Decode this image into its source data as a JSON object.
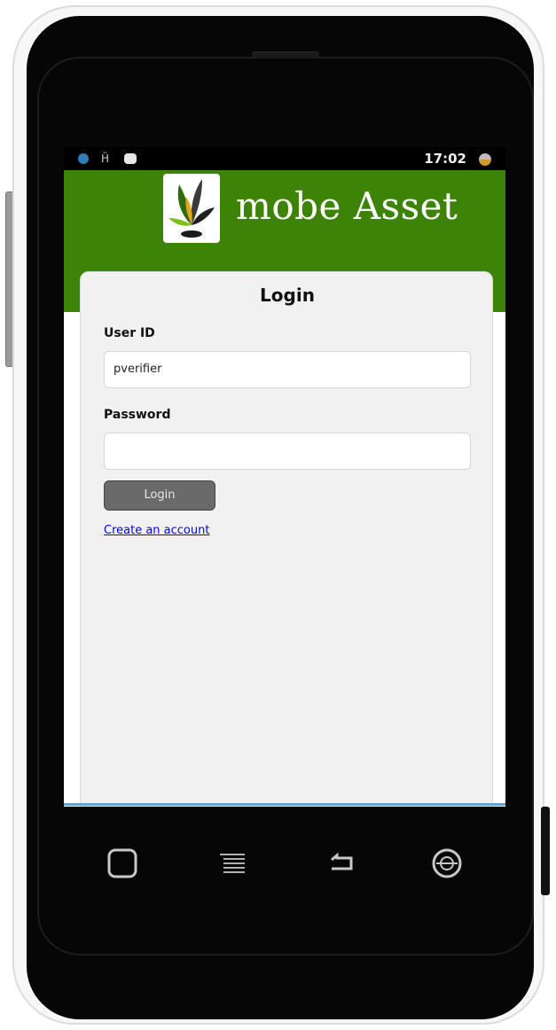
{
  "status_bar": {
    "time": "17:02",
    "icons": [
      "network-globe-icon",
      "signal-h-icon",
      "message-icon",
      "battery-icon"
    ]
  },
  "header": {
    "app_name": "mobe Asset",
    "logo_icon": "plant-leaf-logo-icon",
    "background_color": "#3d8307"
  },
  "login_form": {
    "title": "Login",
    "user_id_label": "User ID",
    "user_id_value": "pverifier",
    "password_label": "Password",
    "password_value": "",
    "login_button_label": "Login",
    "create_account_link": "Create an account"
  },
  "nav_keys": [
    "home-square-icon",
    "menu-lines-icon",
    "back-arrow-icon",
    "search-globe-icon"
  ]
}
